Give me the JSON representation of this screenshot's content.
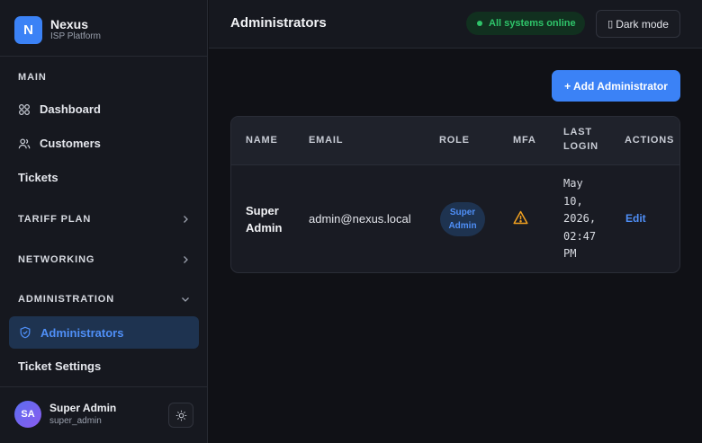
{
  "brand": {
    "logo_letter": "N",
    "name": "Nexus",
    "subtitle": "ISP Platform"
  },
  "sidebar": {
    "main_heading": "MAIN",
    "items": [
      {
        "label": "Dashboard",
        "icon": "dashboard-icon"
      },
      {
        "label": "Customers",
        "icon": "users-icon"
      },
      {
        "label": "Tickets"
      }
    ],
    "sections": [
      {
        "label": "TARIFF PLAN",
        "icon": "chevron-right-icon"
      },
      {
        "label": "NETWORKING",
        "icon": "chevron-right-icon"
      },
      {
        "label": "ADMINISTRATION",
        "icon": "chevron-down-icon"
      }
    ],
    "admin_items": [
      {
        "label": "Administrators",
        "icon": "shield-icon",
        "active": true
      },
      {
        "label": "Ticket Settings"
      }
    ],
    "user": {
      "initials": "SA",
      "name": "Super Admin",
      "handle": "super_admin"
    }
  },
  "header": {
    "title": "Administrators",
    "status": "All systems online",
    "mode_glyph": "▯",
    "mode_label": "Dark mode"
  },
  "main": {
    "add_button": "+ Add Administrator",
    "table": {
      "columns": [
        "NAME",
        "EMAIL",
        "ROLE",
        "MFA",
        "LAST",
        "LOGIN",
        "ACTIONS"
      ],
      "rows": [
        {
          "name_line1": "Super",
          "name_line2": "Admin",
          "email": "admin@nexus.local",
          "role_line1": "Super",
          "role_line2": "Admin",
          "mfa_icon": "warning-icon",
          "login": [
            "May",
            "10,",
            "2026,",
            "02:47",
            "PM"
          ],
          "action": "Edit"
        }
      ]
    }
  },
  "colors": {
    "accent": "#3b82f6",
    "success": "#2fc46a",
    "warning": "#f0a020",
    "background": "#101116",
    "surface": "#16181f"
  }
}
